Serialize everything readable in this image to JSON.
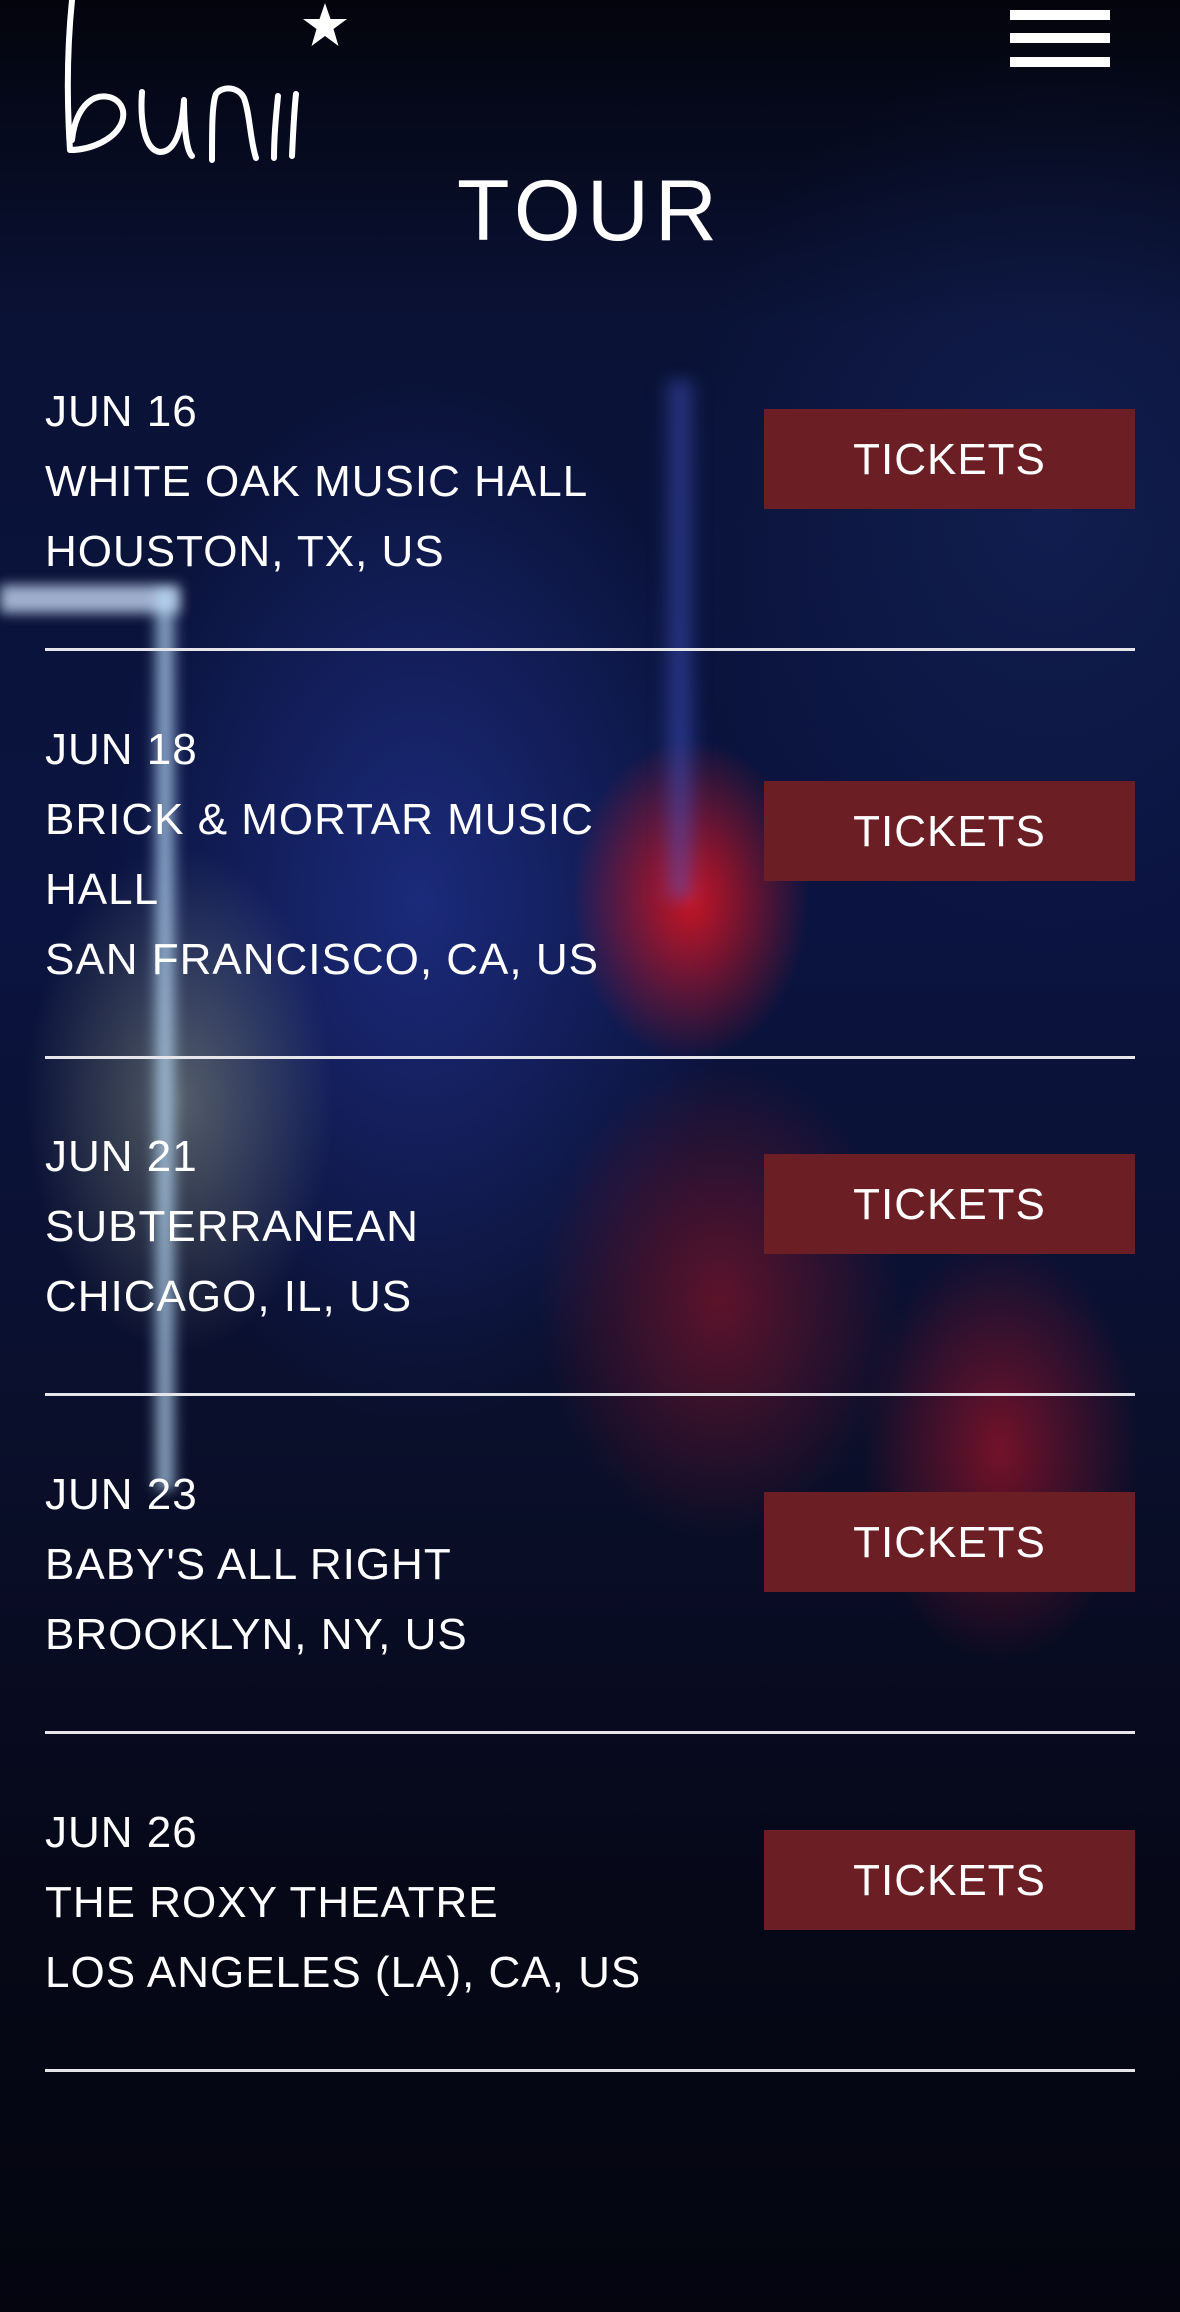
{
  "header": {
    "logo_text": "buni",
    "logo_icon": "star-icon",
    "menu_icon": "hamburger-menu-icon"
  },
  "page": {
    "title": "TOUR"
  },
  "events": [
    {
      "date": "JUN 16",
      "venue": "WHITE OAK MUSIC HALL",
      "venue_line2": "",
      "location": "HOUSTON, TX, US",
      "ticket_label": "TICKETS"
    },
    {
      "date": "JUN 18",
      "venue": "BRICK & MORTAR MUSIC",
      "venue_line2": "HALL",
      "location": "SAN FRANCISCO, CA, US",
      "ticket_label": "TICKETS"
    },
    {
      "date": "JUN 21",
      "venue": "SUBTERRANEAN",
      "venue_line2": "",
      "location": "CHICAGO, IL, US",
      "ticket_label": "TICKETS"
    },
    {
      "date": "JUN 23",
      "venue": "BABY'S ALL RIGHT",
      "venue_line2": "",
      "location": "BROOKLYN, NY, US",
      "ticket_label": "TICKETS"
    },
    {
      "date": "JUN 26",
      "venue": "THE ROXY THEATRE",
      "venue_line2": "",
      "location": "LOS ANGELES (LA), CA, US",
      "ticket_label": "TICKETS"
    }
  ],
  "colors": {
    "ticket_button": "#6b1e24",
    "divider": "#e6e6ea",
    "text": "#ffffff"
  }
}
